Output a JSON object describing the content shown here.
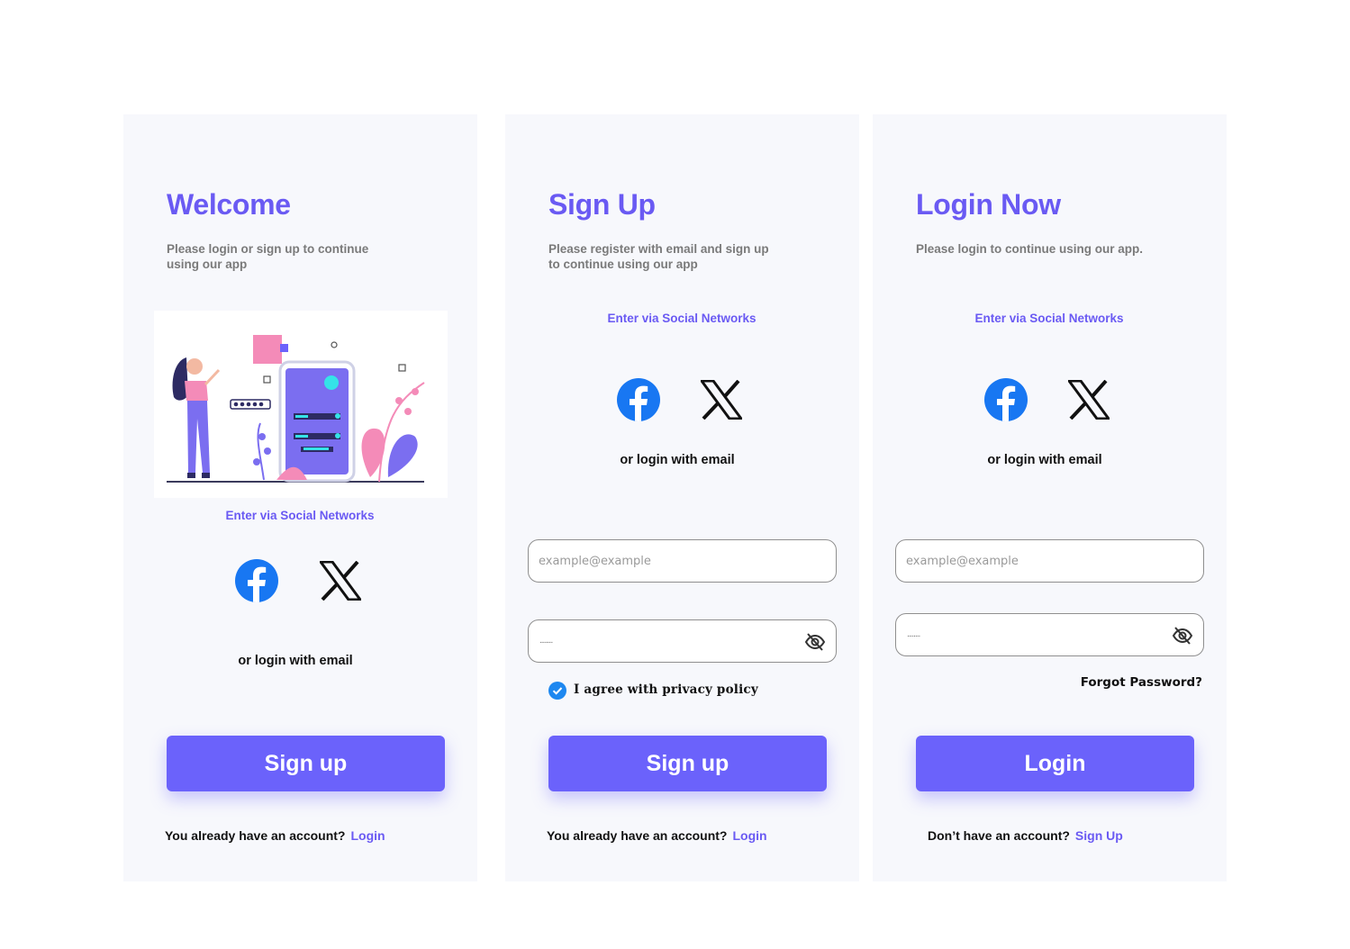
{
  "colors": {
    "accent": "#6a5af3",
    "button": "#6b62fb",
    "panel_bg": "#f7f8fc",
    "facebook": "#1877f2",
    "checkbox": "#1e88f0"
  },
  "welcome": {
    "title": "Welcome",
    "subtitle": "Please login or sign up to continue using our app",
    "illustration": "person-with-phone-login-illustration",
    "social_title": "Enter via Social Networks",
    "social_icons": [
      "facebook-icon",
      "x-icon"
    ],
    "or_text": "or  login with email",
    "button_label": "Sign up",
    "footer_text": "You already have an account?",
    "footer_link": "Login"
  },
  "signup": {
    "title": "Sign Up",
    "subtitle": "Please register with email  and sign up to continue using our app",
    "social_title": "Enter via Social Networks",
    "social_icons": [
      "facebook-icon",
      "x-icon"
    ],
    "or_text": "or  login with email",
    "email_placeholder": "example@example",
    "password_mask": "........",
    "password_icon": "eye-off-icon",
    "privacy_checked": true,
    "privacy_label": "I agree with privacy policy",
    "button_label": "Sign up",
    "footer_text": "You already have an account?",
    "footer_link": "Login"
  },
  "login": {
    "title": "Login Now",
    "subtitle": "Please login to continue using our app.",
    "social_title": "Enter via Social Networks",
    "social_icons": [
      "facebook-icon",
      "x-icon"
    ],
    "or_text": "or  login with email",
    "email_placeholder": "example@example",
    "password_mask": "........",
    "password_icon": "eye-off-icon",
    "forgot_label": "Forgot Password?",
    "button_label": "Login",
    "footer_text": "Don’t have an account?",
    "footer_link": "Sign Up"
  }
}
